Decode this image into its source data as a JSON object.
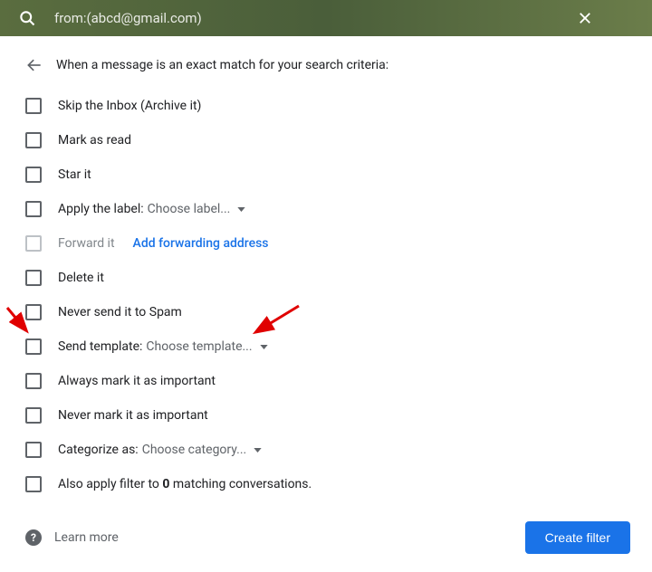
{
  "search": {
    "query": "from:(abcd@gmail.com)"
  },
  "header": {
    "text": "When a message is an exact match for your search criteria:"
  },
  "options": {
    "skip_inbox": "Skip the Inbox (Archive it)",
    "mark_read": "Mark as read",
    "star": "Star it",
    "apply_label": "Apply the label:",
    "apply_label_dropdown": "Choose label...",
    "forward": "Forward it",
    "forward_link": "Add forwarding address",
    "delete": "Delete it",
    "never_spam": "Never send it to Spam",
    "send_template": "Send template:",
    "send_template_dropdown": "Choose template...",
    "always_important": "Always mark it as important",
    "never_important": "Never mark it as important",
    "categorize": "Categorize as:",
    "categorize_dropdown": "Choose category...",
    "also_apply_pre": "Also apply filter to ",
    "also_apply_count": "0",
    "also_apply_post": " matching conversations."
  },
  "footer": {
    "learn_more": "Learn more",
    "create": "Create filter"
  }
}
